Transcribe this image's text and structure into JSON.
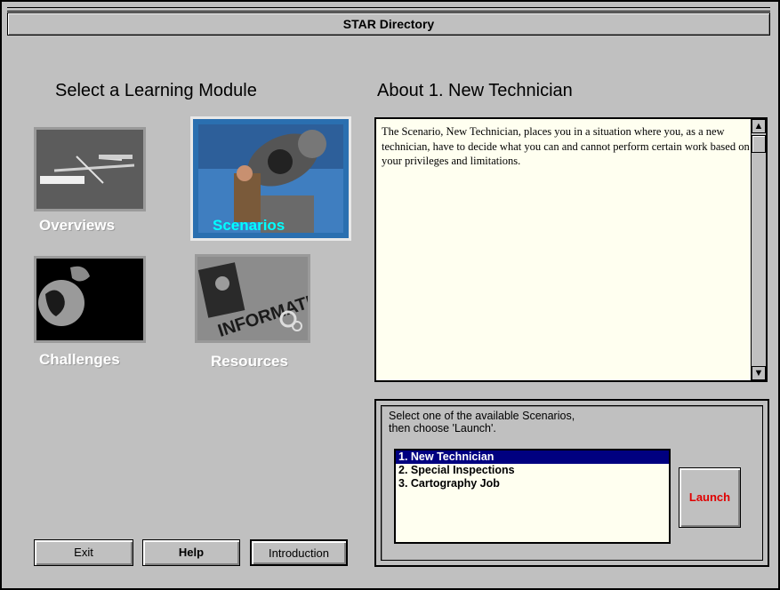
{
  "window": {
    "title": "STAR Directory"
  },
  "left": {
    "heading": "Select a Learning Module",
    "modules": [
      {
        "label": "Overviews",
        "icon": "airplane-overview-icon",
        "selected": false
      },
      {
        "label": "Scenarios",
        "icon": "telescope-scenario-icon",
        "selected": true
      },
      {
        "label": "Challenges",
        "icon": "globe-challenge-icon",
        "selected": false
      },
      {
        "label": "Resources",
        "icon": "information-resource-icon",
        "selected": false
      }
    ]
  },
  "about": {
    "heading": "About 1. New Technician",
    "text": "The Scenario, New Technician, places you in a situation where you, as a new technician, have to decide what you can and cannot perform certain work based on your privileges and limitations."
  },
  "selector": {
    "prompt_line1": "Select one of the available Scenarios,",
    "prompt_line2": "then choose 'Launch'.",
    "items": [
      "1. New Technician",
      "2. Special Inspections",
      "3. Cartography Job"
    ],
    "selected_index": 0,
    "launch_label": "Launch"
  },
  "buttons": {
    "exit": "Exit",
    "help": "Help",
    "introduction": "Introduction"
  },
  "colors": {
    "background": "#c0c0c0",
    "selection": "#000080",
    "launch_text": "#e00000",
    "text_area": "#fffff0"
  }
}
